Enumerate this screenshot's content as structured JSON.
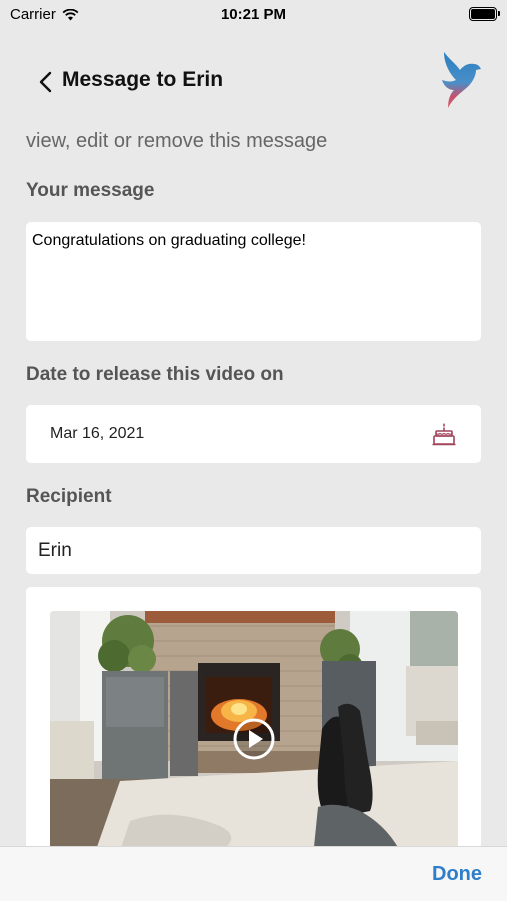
{
  "status": {
    "carrier": "Carrier",
    "time": "10:21 PM"
  },
  "nav": {
    "title": "Message to Erin"
  },
  "subtitle": "view, edit or remove this message",
  "message": {
    "label": "Your message",
    "value": "Congratulations on graduating college!"
  },
  "release_date": {
    "label": "Date to release this video on",
    "value": "Mar 16, 2021",
    "icon": "cake-icon"
  },
  "recipient": {
    "label": "Recipient",
    "value": "Erin"
  },
  "video": {
    "thumbnail": "living-room-fireplace",
    "icon": "play-icon"
  },
  "toolbar": {
    "done_label": "Done"
  },
  "colors": {
    "accent": "#2f7ec9",
    "cake_icon": "#a0455a",
    "background": "#e9e9e9"
  }
}
